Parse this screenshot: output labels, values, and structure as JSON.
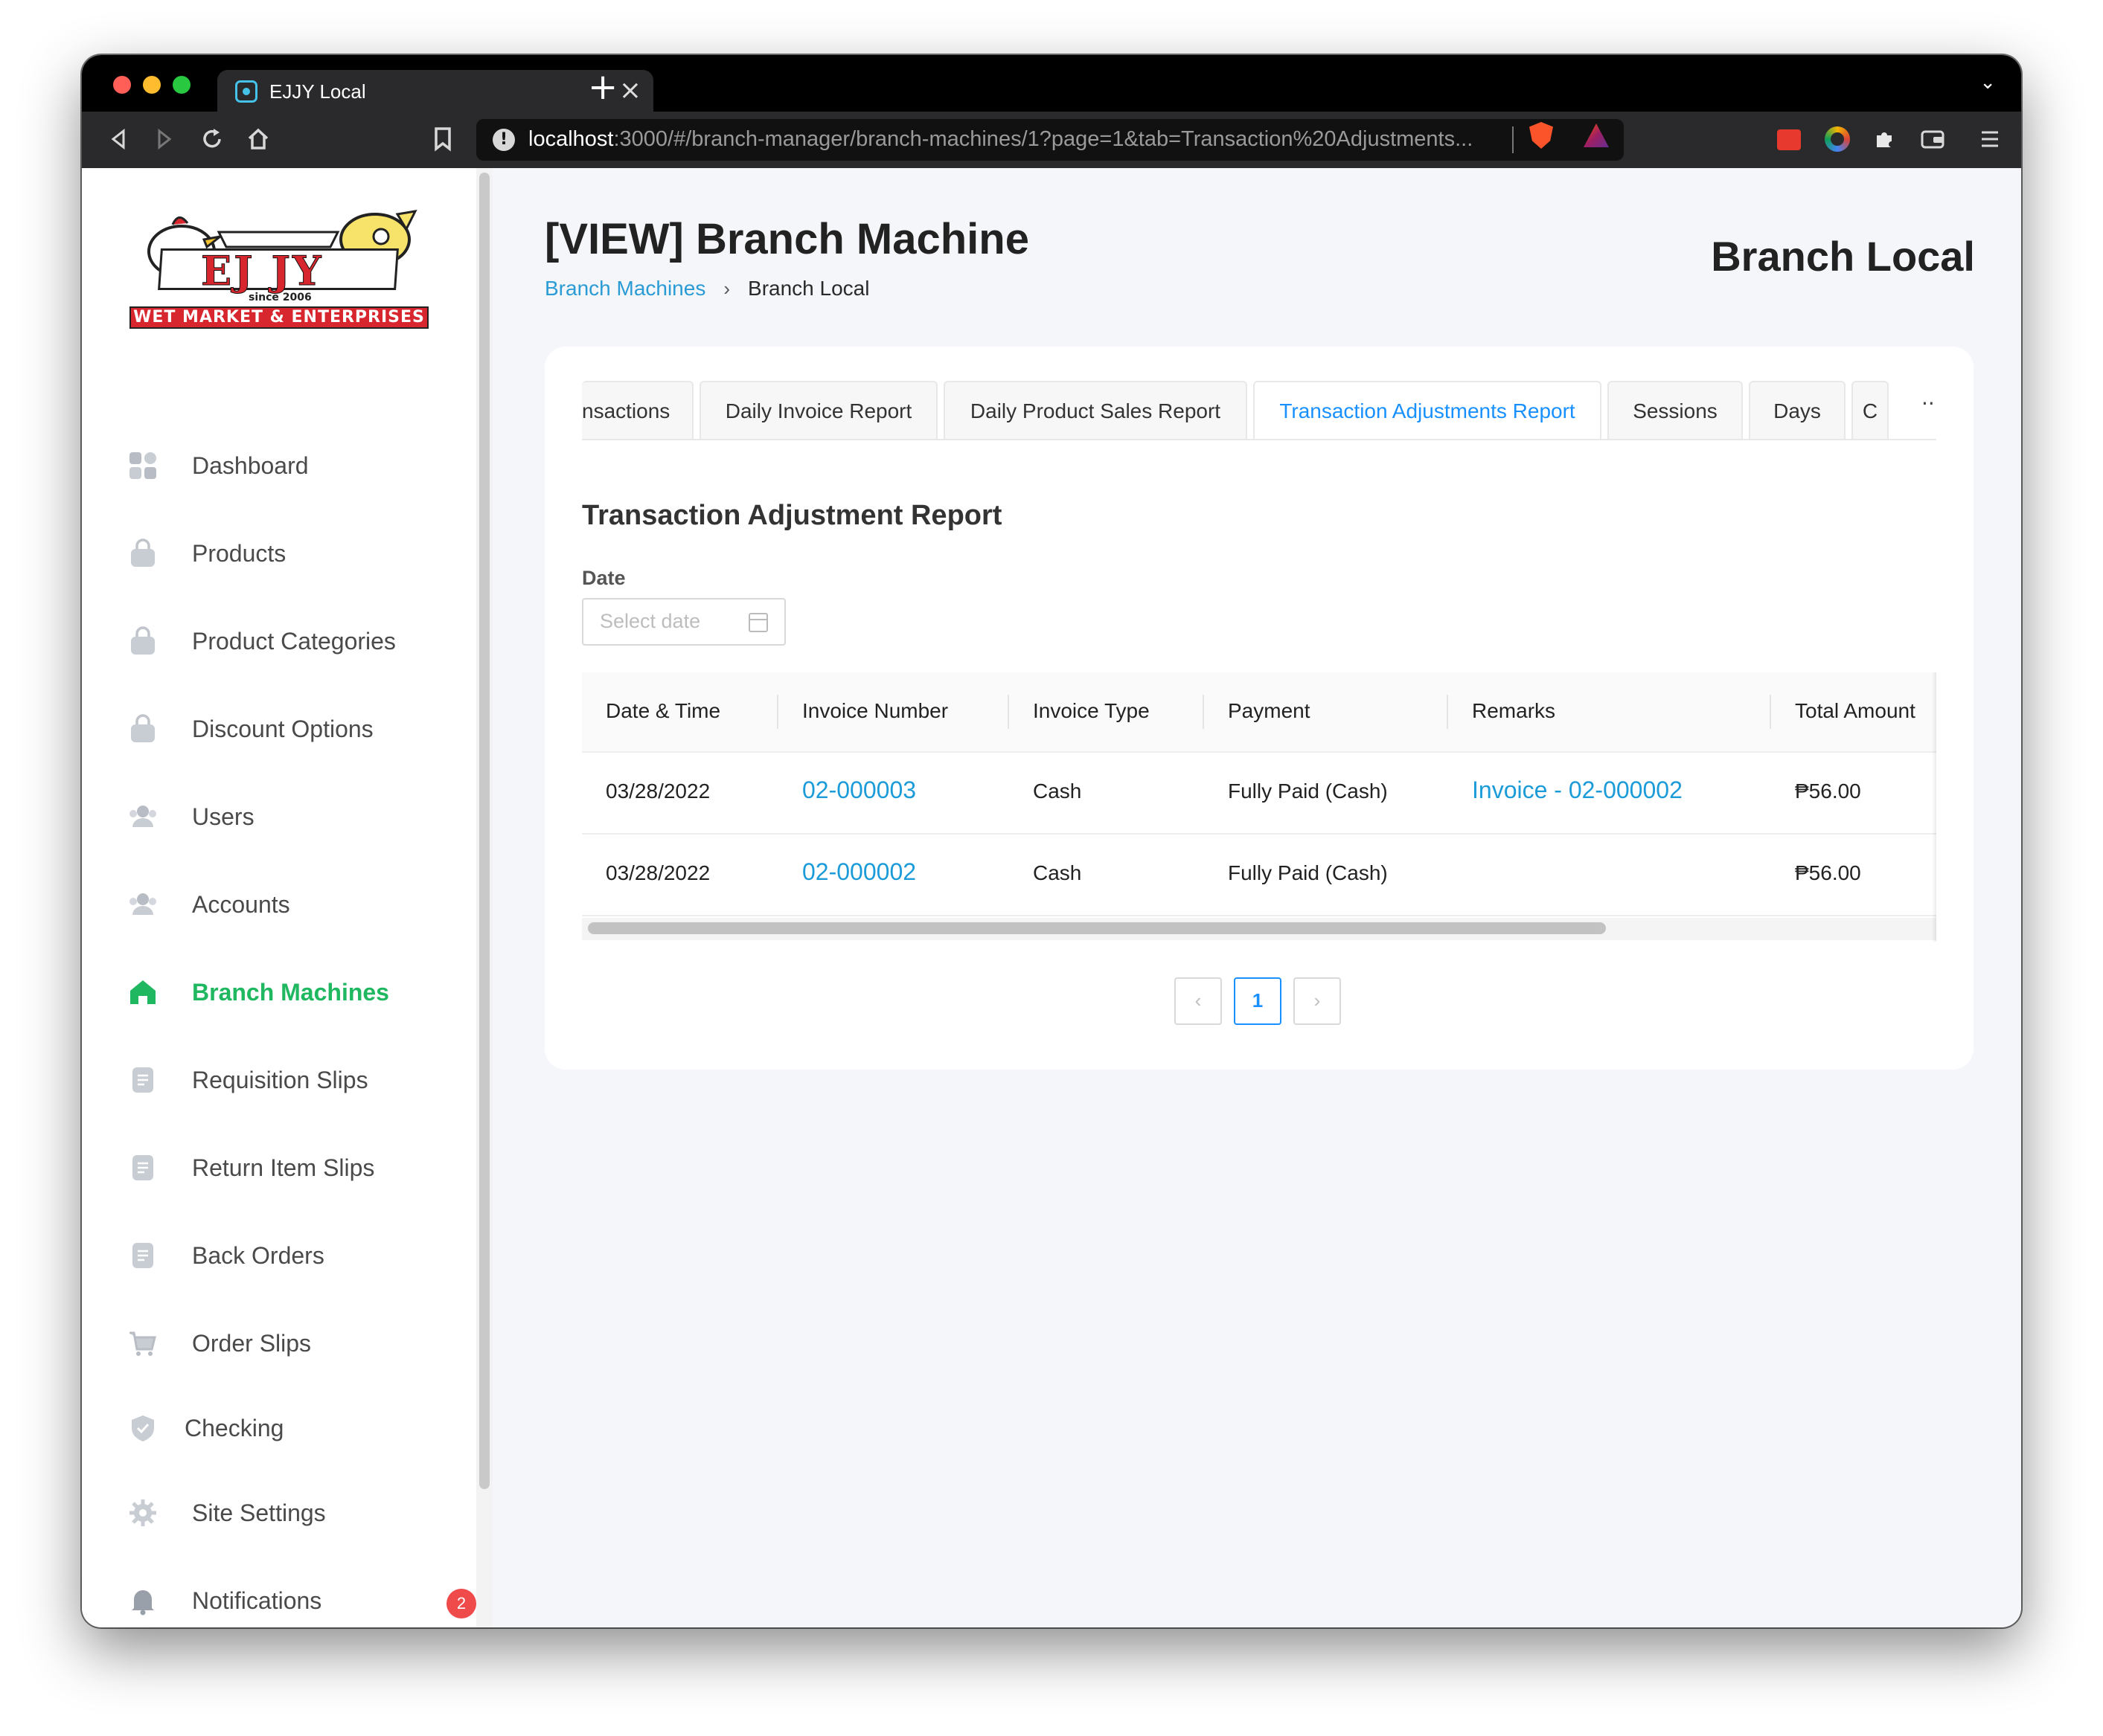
{
  "browser": {
    "tab_title": "EJJY Local",
    "tab_close": "×",
    "new_tab": "+",
    "tab_list": "⌄",
    "url_host": "localhost",
    "url_rest": ":3000/#/branch-manager/branch-machines/1?page=1&tab=Transaction%20Adjustments...",
    "icons": [
      "back-icon",
      "forward-icon",
      "reload-icon",
      "home-icon",
      "bookmark-icon",
      "extensions-icon",
      "wallet-icon",
      "menu-icon"
    ]
  },
  "sidebar": {
    "logo": {
      "main": "EJ JY",
      "since": "since 2006",
      "footer": "WET MARKET & ENTERPRISES"
    },
    "items": [
      {
        "label": "Dashboard",
        "icon": "dashboard-icon"
      },
      {
        "label": "Products",
        "icon": "bag-icon"
      },
      {
        "label": "Product Categories",
        "icon": "bag-icon"
      },
      {
        "label": "Discount Options",
        "icon": "bag-icon"
      },
      {
        "label": "Users",
        "icon": "users-icon"
      },
      {
        "label": "Accounts",
        "icon": "users-icon"
      },
      {
        "label": "Branch Machines",
        "icon": "home-icon",
        "active": true
      },
      {
        "label": "Requisition Slips",
        "icon": "document-icon"
      },
      {
        "label": "Return Item Slips",
        "icon": "document-icon"
      },
      {
        "label": "Back Orders",
        "icon": "document-icon"
      },
      {
        "label": "Order Slips",
        "icon": "cart-icon"
      },
      {
        "label": "Checking",
        "icon": "shield-check-icon"
      },
      {
        "label": "Site Settings",
        "icon": "gear-icon"
      },
      {
        "label": "Notifications",
        "icon": "bell-icon",
        "badge": "2"
      }
    ],
    "active_color": "#1fb760"
  },
  "header": {
    "title": "[VIEW] Branch Machine",
    "branch": "Branch Local",
    "breadcrumb": {
      "link": "Branch Machines",
      "separator": "›",
      "current": "Branch Local"
    }
  },
  "tabs": {
    "items": [
      "nsactions",
      "Daily Invoice Report",
      "Daily Product Sales Report",
      "Transaction Adjustments Report",
      "Sessions",
      "Days",
      "C"
    ],
    "active": "Transaction Adjustments Report",
    "more": "···"
  },
  "report": {
    "title": "Transaction Adjustment Report",
    "date_label": "Date",
    "date_placeholder": "Select date"
  },
  "table": {
    "columns": [
      "Date & Time",
      "Invoice Number",
      "Invoice Type",
      "Payment",
      "Remarks",
      "Total Amount"
    ],
    "rows": [
      {
        "date": "03/28/2022",
        "invoice": "02-000003",
        "type": "Cash",
        "payment": "Fully Paid (Cash)",
        "remarks": "Invoice - 02-000002",
        "total": "₱56.00"
      },
      {
        "date": "03/28/2022",
        "invoice": "02-000002",
        "type": "Cash",
        "payment": "Fully Paid (Cash)",
        "remarks": "",
        "total": "₱56.00"
      }
    ]
  },
  "pagination": {
    "prev": "‹",
    "current": "1",
    "next": "›"
  },
  "colors": {
    "link": "#1c9bd9",
    "active_tab": "#1890ff",
    "badge": "#ef4b4b"
  }
}
